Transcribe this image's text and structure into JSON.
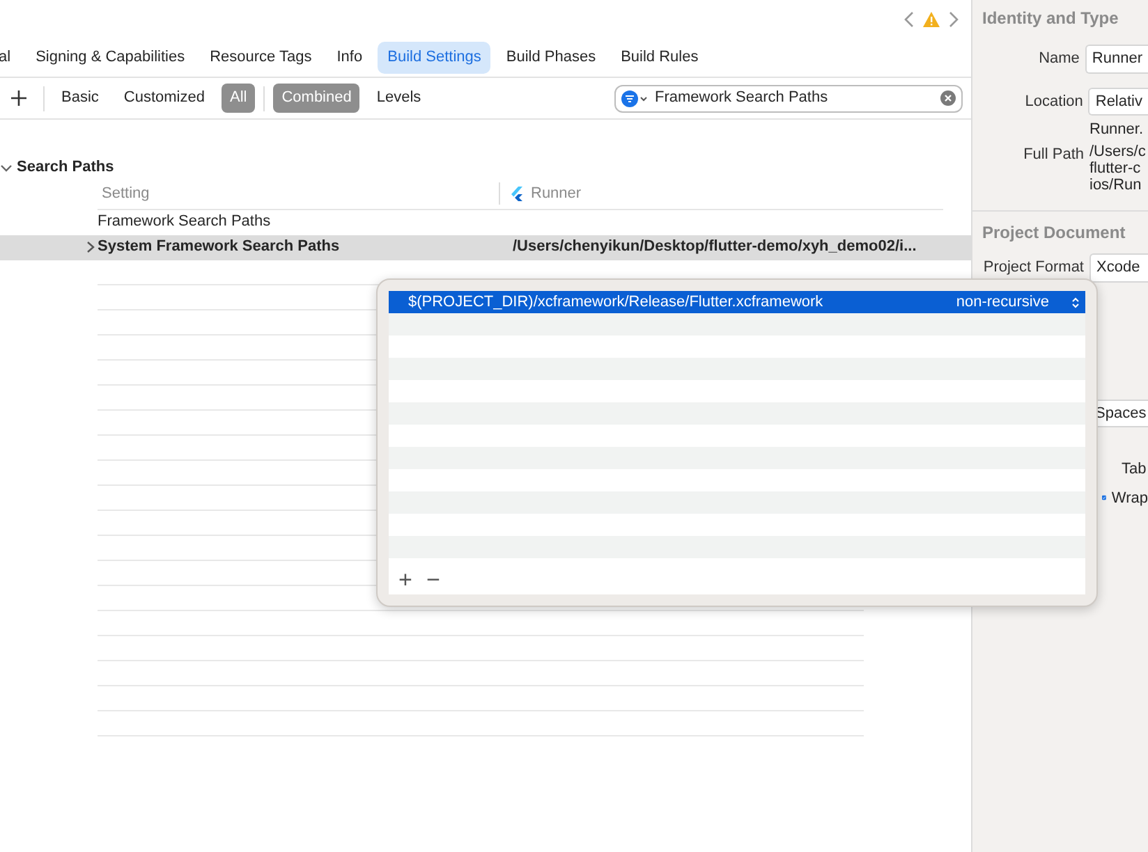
{
  "tabs": [
    {
      "label": "al",
      "selected": false
    },
    {
      "label": "Signing & Capabilities",
      "selected": false
    },
    {
      "label": "Resource Tags",
      "selected": false
    },
    {
      "label": "Info",
      "selected": false
    },
    {
      "label": "Build Settings",
      "selected": true
    },
    {
      "label": "Build Phases",
      "selected": false
    },
    {
      "label": "Build Rules",
      "selected": false
    }
  ],
  "scope_filters": [
    {
      "label": "Basic",
      "selected": false
    },
    {
      "label": "Customized",
      "selected": false
    },
    {
      "label": "All",
      "selected": true
    }
  ],
  "view_filters": [
    {
      "label": "Combined",
      "selected": true
    },
    {
      "label": "Levels",
      "selected": false
    }
  ],
  "search": {
    "value": "Framework Search Paths"
  },
  "section": {
    "title": "Search Paths",
    "expanded": true
  },
  "columns": [
    "Setting",
    "Runner"
  ],
  "settings": [
    {
      "name": "Framework Search Paths",
      "customized": false,
      "selected": false
    },
    {
      "name": "System Framework Search Paths",
      "value": "/Users/chenyikun/Desktop/flutter-demo/xyh_demo02/i...",
      "customized": true,
      "selected": true
    }
  ],
  "popover": {
    "rows": [
      {
        "path": "$(PROJECT_DIR)/xcframework/Release/Flutter.xcframework",
        "recursion": "non-recursive",
        "selected": true
      }
    ],
    "add": "+",
    "remove": "−"
  },
  "inspector": {
    "identity_title": "Identity and Type",
    "name_label": "Name",
    "name_value": "Runner",
    "location_label": "Location",
    "location_value": "Relativ",
    "file_name": "Runner.",
    "full_path_label": "Full Path",
    "full_path_lines": [
      "/Users/c",
      "flutter-c",
      "ios/Run"
    ],
    "document_title": "Project Document",
    "format_label": "Project Format",
    "format_value": "Xcode",
    "indent_value": "Spaces",
    "tab_label": "Tab",
    "wrap_label": "Wrap",
    "wrap_checked": true
  }
}
